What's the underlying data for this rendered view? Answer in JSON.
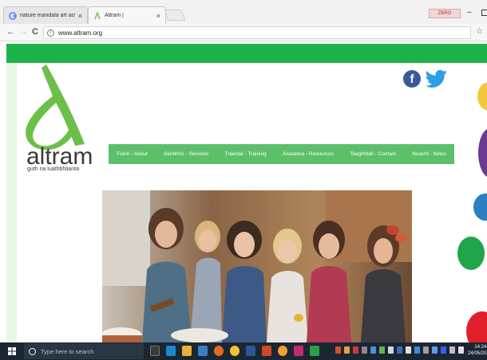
{
  "browser": {
    "tabs": [
      {
        "title": "nature mandala art acti",
        "close": "×"
      },
      {
        "title": "Altram |",
        "close": "×"
      }
    ],
    "extension_badge": "ZBRO",
    "url": "www.altram.org",
    "info_icon": "i",
    "back": "←",
    "forward": "→",
    "reload": "C",
    "bookmark": "☆",
    "minimize": "–"
  },
  "site": {
    "logo_word": "altram",
    "logo_tagline": "guth na luathbhlianta",
    "facebook_glyph": "f",
    "nav": [
      "Fúinn - About",
      "Seirbhísí - Services",
      "Traenáil - Training",
      "Áiseanna - Resources",
      "Teagmháil - Contact",
      "Nuacht - News"
    ],
    "colors": {
      "band_green": "#1cb24a",
      "nav_green": "#5cc06a",
      "logo_green": "#6cc04a"
    }
  },
  "taskbar": {
    "search_placeholder": "Type here to search",
    "time": "14:24",
    "date": "24/05/20"
  }
}
